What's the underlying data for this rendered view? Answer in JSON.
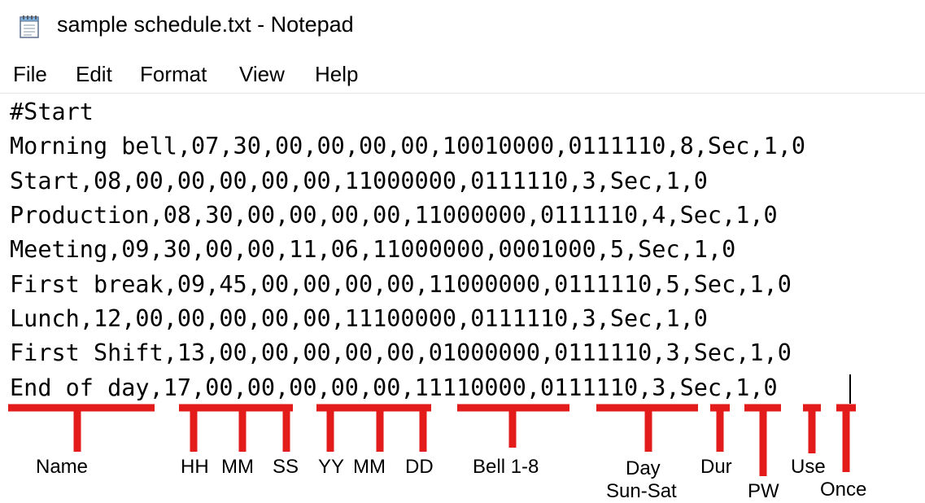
{
  "window": {
    "title": "sample schedule.txt - Notepad",
    "icon": "notepad-icon"
  },
  "menu": [
    "File",
    "Edit",
    "Format",
    "View",
    "Help"
  ],
  "editor": {
    "lines": [
      "#Start",
      "Morning bell,07,30,00,00,00,00,10010000,0111110,8,Sec,1,0",
      "Start,08,00,00,00,00,00,11000000,0111110,3,Sec,1,0",
      "Production,08,30,00,00,00,00,11000000,0111110,4,Sec,1,0",
      "Meeting,09,30,00,00,11,06,11000000,0001000,5,Sec,1,0",
      "First break,09,45,00,00,00,00,11000000,0111110,5,Sec,1,0",
      "Lunch,12,00,00,00,00,00,11100000,0111110,3,Sec,1,0",
      "First Shift,13,00,00,00,00,00,01000000,0111110,3,Sec,1,0",
      "End of day,17,00,00,00,00,00,11110000,0111110,3,Sec,1,0"
    ]
  },
  "annotations": {
    "color": "#e31b1b",
    "labels": {
      "name": "Name",
      "hh": "HH",
      "mm": "MM",
      "ss": "SS",
      "yy": "YY",
      "mo": "MM",
      "dd": "DD",
      "bell": "Bell 1-8",
      "day": "Day",
      "sunsat": "Sun-Sat",
      "dur": "Dur",
      "pw": "PW",
      "use": "Use",
      "once": "Once"
    }
  }
}
